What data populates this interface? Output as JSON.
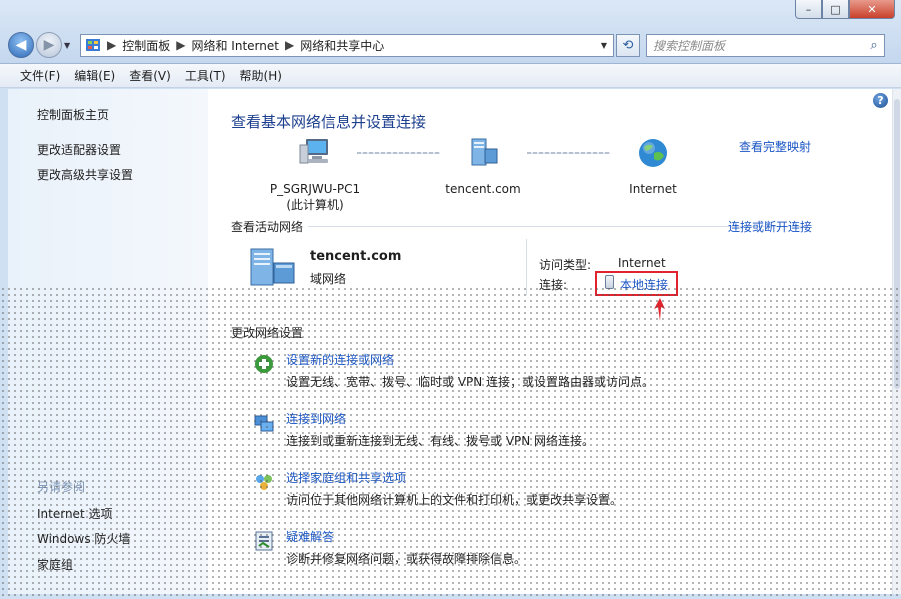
{
  "window": {
    "min": "–",
    "max": "□",
    "close": "✕"
  },
  "nav": {
    "breadcrumb": [
      "控制面板",
      "网络和 Internet",
      "网络和共享中心"
    ],
    "search_placeholder": "搜索控制面板"
  },
  "menu": [
    "文件(F)",
    "编辑(E)",
    "查看(V)",
    "工具(T)",
    "帮助(H)"
  ],
  "sidebar": {
    "home": "控制面板主页",
    "links": [
      "更改适配器设置",
      "更改高级共享设置"
    ],
    "see_also_title": "另请参阅",
    "see_also": [
      "Internet 选项",
      "Windows 防火墙",
      "家庭组"
    ]
  },
  "main": {
    "title": "查看基本网络信息并设置连接",
    "full_map": "查看完整映射",
    "nodes": [
      {
        "label": "P_SGRJWU-PC1",
        "sub": "(此计算机)",
        "icon": "computer-icon"
      },
      {
        "label": "tencent.com",
        "sub": "",
        "icon": "domain-network-icon"
      },
      {
        "label": "Internet",
        "sub": "",
        "icon": "globe-icon"
      }
    ],
    "active_title": "查看活动网络",
    "connect_link": "连接或断开连接",
    "network": {
      "name": "tencent.com",
      "type": "域网络"
    },
    "access_type_label": "访问类型:",
    "access_type_value": "Internet",
    "connection_label": "连接:",
    "connection_value": "本地连接",
    "change_title": "更改网络设置",
    "tasks": [
      {
        "title": "设置新的连接或网络",
        "desc": "设置无线、宽带、拨号、临时或 VPN 连接；或设置路由器或访问点。",
        "icon": "new-connection-icon"
      },
      {
        "title": "连接到网络",
        "desc": "连接到或重新连接到无线、有线、拨号或 VPN 网络连接。",
        "icon": "connect-network-icon"
      },
      {
        "title": "选择家庭组和共享选项",
        "desc": "访问位于其他网络计算机上的文件和打印机，或更改共享设置。",
        "icon": "homegroup-icon"
      },
      {
        "title": "疑难解答",
        "desc": "诊断并修复网络问题，或获得故障排除信息。",
        "icon": "troubleshoot-icon"
      }
    ]
  },
  "colors": {
    "link": "#1a56c4",
    "title": "#1c3f8e",
    "highlight": "#e0232c"
  }
}
